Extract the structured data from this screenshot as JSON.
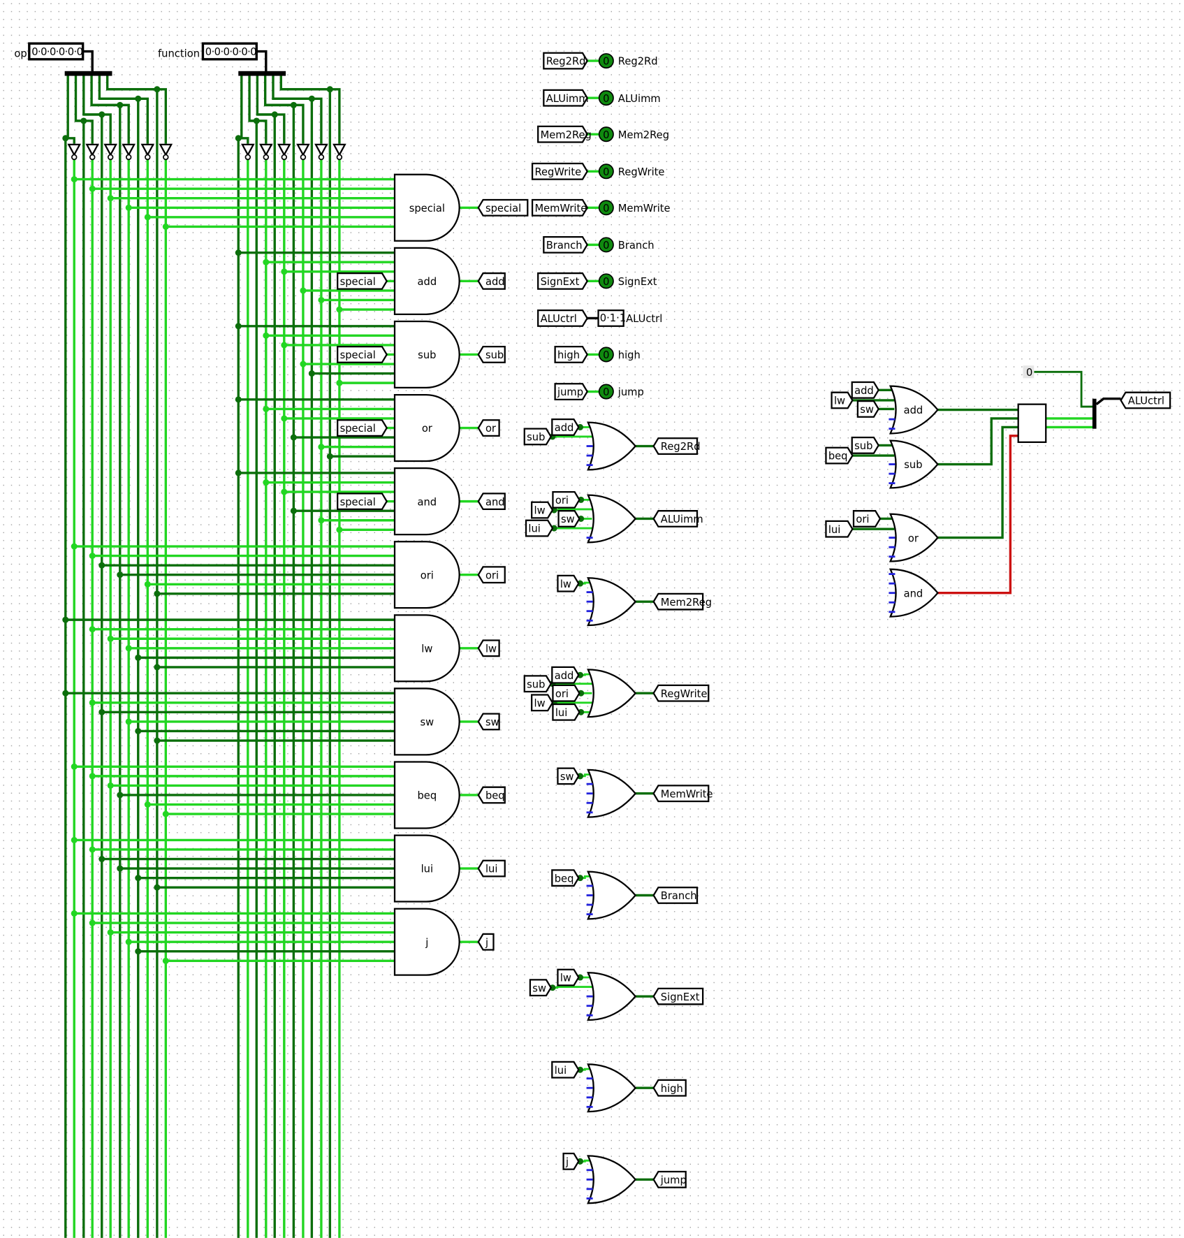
{
  "inputs": {
    "op": {
      "label": "op",
      "value": "0·0·0·0·0·0"
    },
    "function": {
      "label": "function",
      "value": "0·0·0·0·0·0"
    }
  },
  "and_gates": [
    {
      "name": "special",
      "tunnel_in": "",
      "tunnel_out": "special"
    },
    {
      "name": "add",
      "tunnel_in": "special",
      "tunnel_out": "add"
    },
    {
      "name": "sub",
      "tunnel_in": "special",
      "tunnel_out": "sub"
    },
    {
      "name": "or",
      "tunnel_in": "special",
      "tunnel_out": "or"
    },
    {
      "name": "and",
      "tunnel_in": "special",
      "tunnel_out": "and"
    },
    {
      "name": "ori",
      "tunnel_in": "",
      "tunnel_out": "ori"
    },
    {
      "name": "lw",
      "tunnel_in": "",
      "tunnel_out": "lw"
    },
    {
      "name": "sw",
      "tunnel_in": "",
      "tunnel_out": "sw"
    },
    {
      "name": "beq",
      "tunnel_in": "",
      "tunnel_out": "beq"
    },
    {
      "name": "lui",
      "tunnel_in": "",
      "tunnel_out": "lui"
    },
    {
      "name": "j",
      "tunnel_in": "",
      "tunnel_out": "j"
    }
  ],
  "probes": [
    {
      "tunnel": "Reg2Rd",
      "value": "0",
      "label": "Reg2Rd"
    },
    {
      "tunnel": "ALUimm",
      "value": "0",
      "label": "ALUimm"
    },
    {
      "tunnel": "Mem2Reg",
      "value": "0",
      "label": "Mem2Reg"
    },
    {
      "tunnel": "RegWrite",
      "value": "0",
      "label": "RegWrite"
    },
    {
      "tunnel": "MemWrite",
      "value": "0",
      "label": "MemWrite"
    },
    {
      "tunnel": "Branch",
      "value": "0",
      "label": "Branch"
    },
    {
      "tunnel": "SignExt",
      "value": "0",
      "label": "SignExt"
    },
    {
      "tunnel": "ALUctrl",
      "value": "0·1·1",
      "label": "ALUctrl"
    },
    {
      "tunnel": "high",
      "value": "0",
      "label": "high"
    },
    {
      "tunnel": "jump",
      "value": "0",
      "label": "jump"
    }
  ],
  "or_gates": [
    {
      "inputs": [
        "add",
        "sub"
      ],
      "output": "Reg2Rd"
    },
    {
      "inputs": [
        "ori",
        "lw",
        "sw",
        "lui"
      ],
      "output": "ALUimm"
    },
    {
      "inputs": [
        "lw"
      ],
      "output": "Mem2Reg"
    },
    {
      "inputs": [
        "add",
        "sub",
        "ori",
        "lw",
        "lui"
      ],
      "output": "RegWrite"
    },
    {
      "inputs": [
        "sw"
      ],
      "output": "MemWrite"
    },
    {
      "inputs": [
        "beq"
      ],
      "output": "Branch"
    },
    {
      "inputs": [
        "lw",
        "sw"
      ],
      "output": "SignExt"
    },
    {
      "inputs": [
        "lui"
      ],
      "output": "high"
    },
    {
      "inputs": [
        "j"
      ],
      "output": "jump"
    }
  ],
  "alu_section": {
    "gates": [
      {
        "label": "add",
        "inputs": [
          "add",
          "lw",
          "sw"
        ]
      },
      {
        "label": "sub",
        "inputs": [
          "sub",
          "beq"
        ]
      },
      {
        "label": "or",
        "inputs": [
          "ori",
          "lui"
        ]
      },
      {
        "label": "and",
        "inputs": []
      }
    ],
    "constant": "0",
    "output": "ALUctrl"
  },
  "colors": {
    "wire_high": "#22d622",
    "wire_low": "#0b6e0b",
    "wire_error": "#cc1111",
    "unconnected": "#2222dd",
    "grid_dot": "#9a9a9a"
  }
}
